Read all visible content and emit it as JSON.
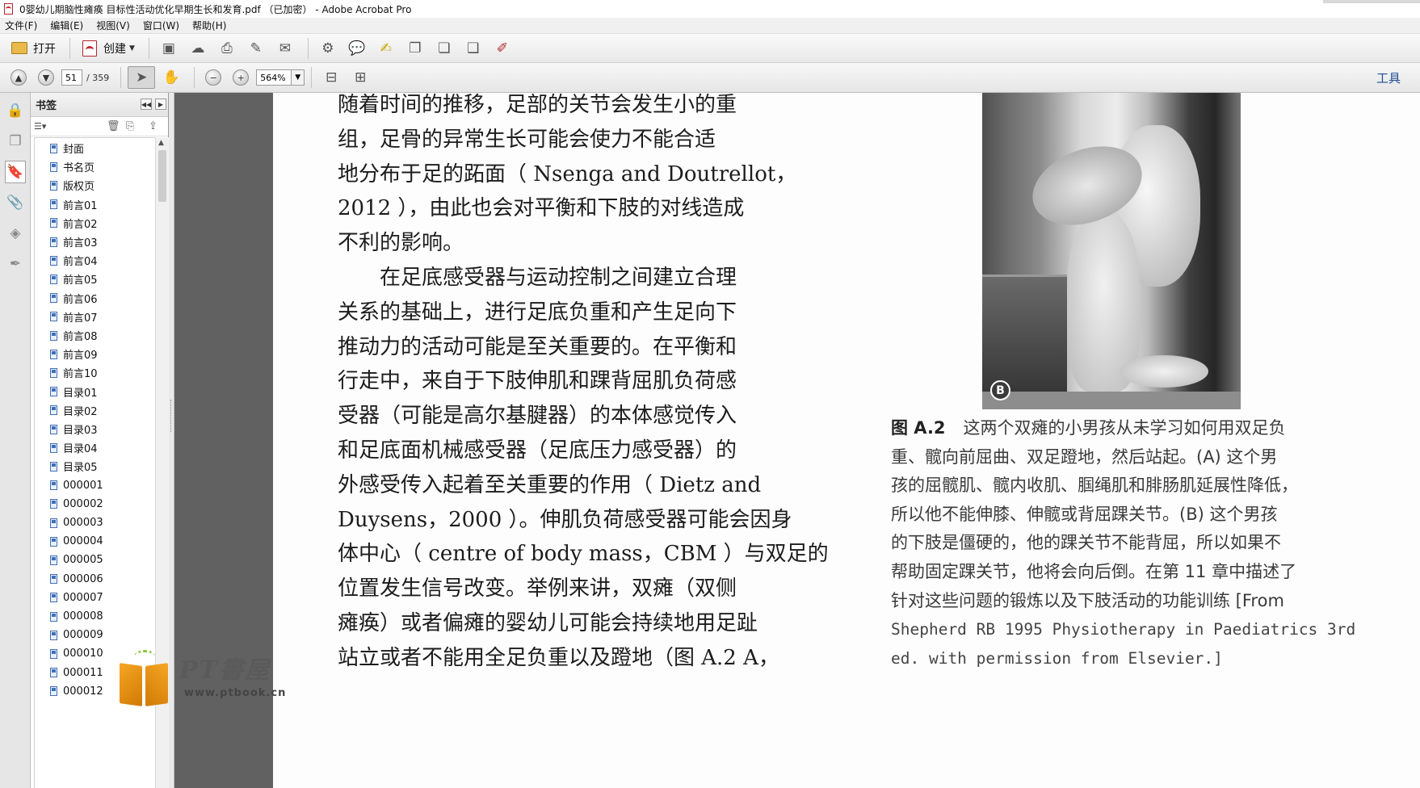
{
  "window": {
    "title": "0婴幼儿期脑性瘫痪 目标性活动优化早期生长和发育.pdf （已加密） - Adobe Acrobat Pro"
  },
  "menu": [
    "文件(F)",
    "编辑(E)",
    "视图(V)",
    "窗口(W)",
    "帮助(H)"
  ],
  "toolbar": {
    "open_label": "打开",
    "create_label": "创建",
    "tools_label": "工具"
  },
  "navigation": {
    "current_page": "51",
    "total_pages": "/ 359",
    "zoom": "564%"
  },
  "bookmarks": {
    "title": "书签",
    "items": [
      "封面",
      "书名页",
      "版权页",
      "前言01",
      "前言02",
      "前言03",
      "前言04",
      "前言05",
      "前言06",
      "前言07",
      "前言08",
      "前言09",
      "前言10",
      "目录01",
      "目录02",
      "目录03",
      "目录04",
      "目录05",
      "000001",
      "000002",
      "000003",
      "000004",
      "000005",
      "000006",
      "000007",
      "000008",
      "000009",
      "000010",
      "000011",
      "000012"
    ]
  },
  "document": {
    "body_lines": [
      "随着时间的推移，足部的关节会发生小的重",
      "组，足骨的异常生长可能会使力不能合适",
      "地分布于足的跖面（ Nsenga and Doutrellot，",
      "2012 ），由此也会对平衡和下肢的对线造成",
      "不利的影响。",
      "　　在足底感受器与运动控制之间建立合理",
      "关系的基础上，进行足底负重和产生足向下",
      "推动力的活动可能是至关重要的。在平衡和",
      "行走中，来自于下肢伸肌和踝背屈肌负荷感",
      "受器（可能是高尔基腱器）的本体感觉传入",
      "和足底面机械感受器（足底压力感受器）的",
      "外感受传入起着至关重要的作用（ Dietz and",
      "Duysens，2000 ）。伸肌负荷感受器可能会因身",
      "体中心（ centre of body mass，CBM ）与双足的",
      "位置发生信号改变。举例来讲，双瘫（双侧",
      "瘫痪）或者偏瘫的婴幼儿可能会持续地用足趾",
      "站立或者不能用全足负重以及蹬地（图 A.2 A，"
    ],
    "figure_panel_label": "B",
    "caption_label": "图 A.2",
    "caption_lines": [
      "这两个双瘫的小男孩从未学习如何用双足负",
      "重、髋向前屈曲、双足蹬地，然后站起。(A) 这个男",
      "孩的屈髋肌、髋内收肌、腘绳肌和腓肠肌延展性降低，",
      "所以他不能伸膝、伸髋或背屈踝关节。(B) 这个男孩",
      "的下肢是僵硬的，他的踝关节不能背屈，所以如果不",
      "帮助固定踝关节，他将会向后倒。在第 11 章中描述了",
      "针对这些问题的锻炼以及下肢活动的功能训练 [From",
      "Shepherd RB 1995 Physiotherapy in Paediatrics 3rd",
      "ed. with permission from Elsevier.]"
    ]
  },
  "watermark": {
    "brand": "PT書屋",
    "url": "www.ptbook.cn"
  },
  "colors": {
    "viewer_background": "#616161",
    "tools_link": "#1f4e96",
    "bookmark_icon": "#3f6fb5",
    "acrobat_red": "#c8252b",
    "watermark_orange": "#f6a623"
  }
}
